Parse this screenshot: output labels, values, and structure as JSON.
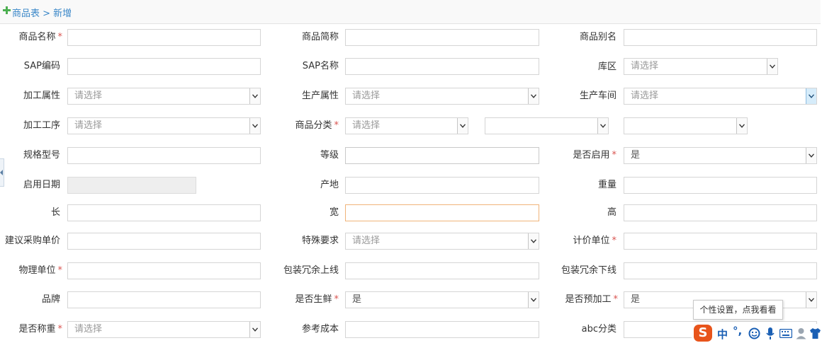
{
  "breadcrumb": "商品表 > 新增",
  "ime": {
    "tooltip": "个性设置，点我看看",
    "logo": "S",
    "mode": "中",
    "punct": "°,"
  },
  "fields": {
    "name": {
      "label": "商品名称",
      "required": true
    },
    "short_name": {
      "label": "商品简称"
    },
    "alias": {
      "label": "商品别名"
    },
    "sap_code": {
      "label": "SAP编码"
    },
    "sap_name": {
      "label": "SAP名称"
    },
    "warehouse_zone": {
      "label": "库区",
      "value": "请选择"
    },
    "process_attr": {
      "label": "加工属性",
      "value": "请选择"
    },
    "production_attr": {
      "label": "生产属性",
      "value": "请选择"
    },
    "workshop": {
      "label": "生产车间",
      "value": "请选择"
    },
    "process_step": {
      "label": "加工工序",
      "value": "请选择"
    },
    "category": {
      "label": "商品分类",
      "required": true,
      "value": "请选择",
      "value2": "",
      "value3": ""
    },
    "spec_model": {
      "label": "规格型号"
    },
    "grade": {
      "label": "等级"
    },
    "enabled": {
      "label": "是否启用",
      "required": true,
      "value": "是"
    },
    "enable_date": {
      "label": "启用日期"
    },
    "origin": {
      "label": "产地"
    },
    "weight": {
      "label": "重量"
    },
    "length": {
      "label": "长"
    },
    "width": {
      "label": "宽"
    },
    "height": {
      "label": "高"
    },
    "suggested_price": {
      "label": "建议采购单价"
    },
    "special_req": {
      "label": "特殊要求",
      "value": "请选择"
    },
    "pricing_unit": {
      "label": "计价单位",
      "required": true
    },
    "physical_unit": {
      "label": "物理单位",
      "required": true
    },
    "pack_upper": {
      "label": "包装冗余上线"
    },
    "pack_lower": {
      "label": "包装冗余下线"
    },
    "brand": {
      "label": "品牌"
    },
    "is_fresh": {
      "label": "是否生鲜",
      "required": true,
      "value": "是"
    },
    "is_preprocessed": {
      "label": "是否预加工",
      "required": true,
      "value": "是"
    },
    "is_weighed": {
      "label": "是否称重",
      "required": true,
      "value": "请选择"
    },
    "ref_cost": {
      "label": "参考成本"
    },
    "abc_class": {
      "label": "abc分类"
    }
  },
  "colors": {
    "required": "#d9534f",
    "breadcrumb": "#3a87c8",
    "plus": "#4caf50",
    "focus_border": "#f0b47a"
  }
}
